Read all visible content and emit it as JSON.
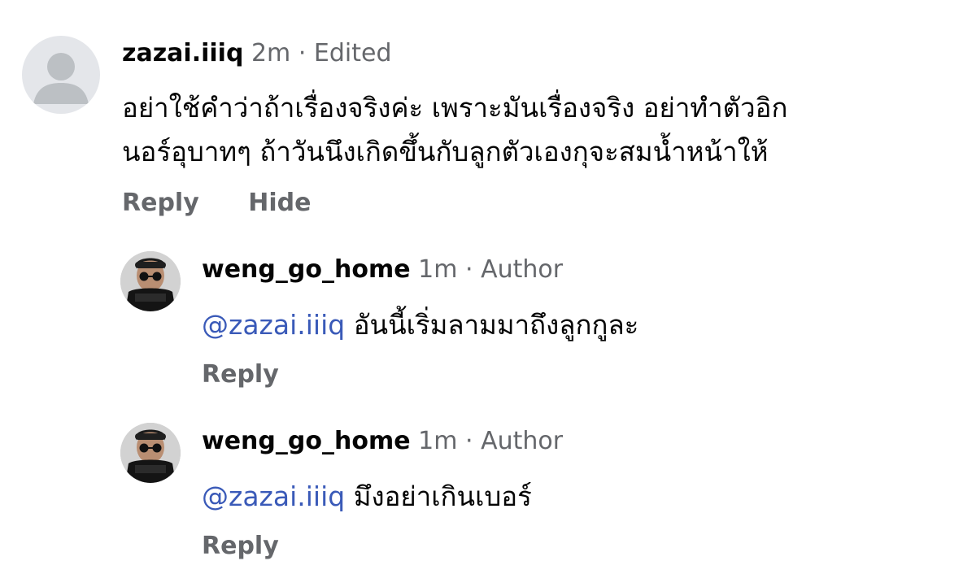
{
  "comments": [
    {
      "username": "zazai.iiiq",
      "time": "2m",
      "separator": "·",
      "tag": "Edited",
      "avatar": "default-avatar-icon",
      "lines": [
        "อย่าใช้คำว่าถ้าเรื่องจริงค่ะ เพราะมันเรื่องจริง อย่าทำตัวอิก",
        "นอร์อุบาทๆ ถ้าวันนึงเกิดขึ้นกับลูกตัวเองกุจะสมน้ำหน้าให้"
      ],
      "actions": [
        "Reply",
        "Hide"
      ]
    }
  ],
  "replies": [
    {
      "username": "weng_go_home",
      "time": "1m",
      "separator": "·",
      "tag": "Author",
      "avatar": "profile-photo",
      "mention": "@zazai.iiiq",
      "text": "อันนี้เริ่มลามมาถึงลูกกูละ",
      "actions": [
        "Reply"
      ]
    },
    {
      "username": "weng_go_home",
      "time": "1m",
      "separator": "·",
      "tag": "Author",
      "avatar": "profile-photo",
      "mention": "@zazai.iiiq",
      "text": "มึงอย่าเกินเบอร์",
      "actions": [
        "Reply"
      ]
    }
  ],
  "colors": {
    "text": "#050505",
    "meta": "#65676b",
    "mention": "#3a5ab8",
    "avatar_bg": "#e4e6ea",
    "avatar_fg": "#bcc0c4"
  }
}
